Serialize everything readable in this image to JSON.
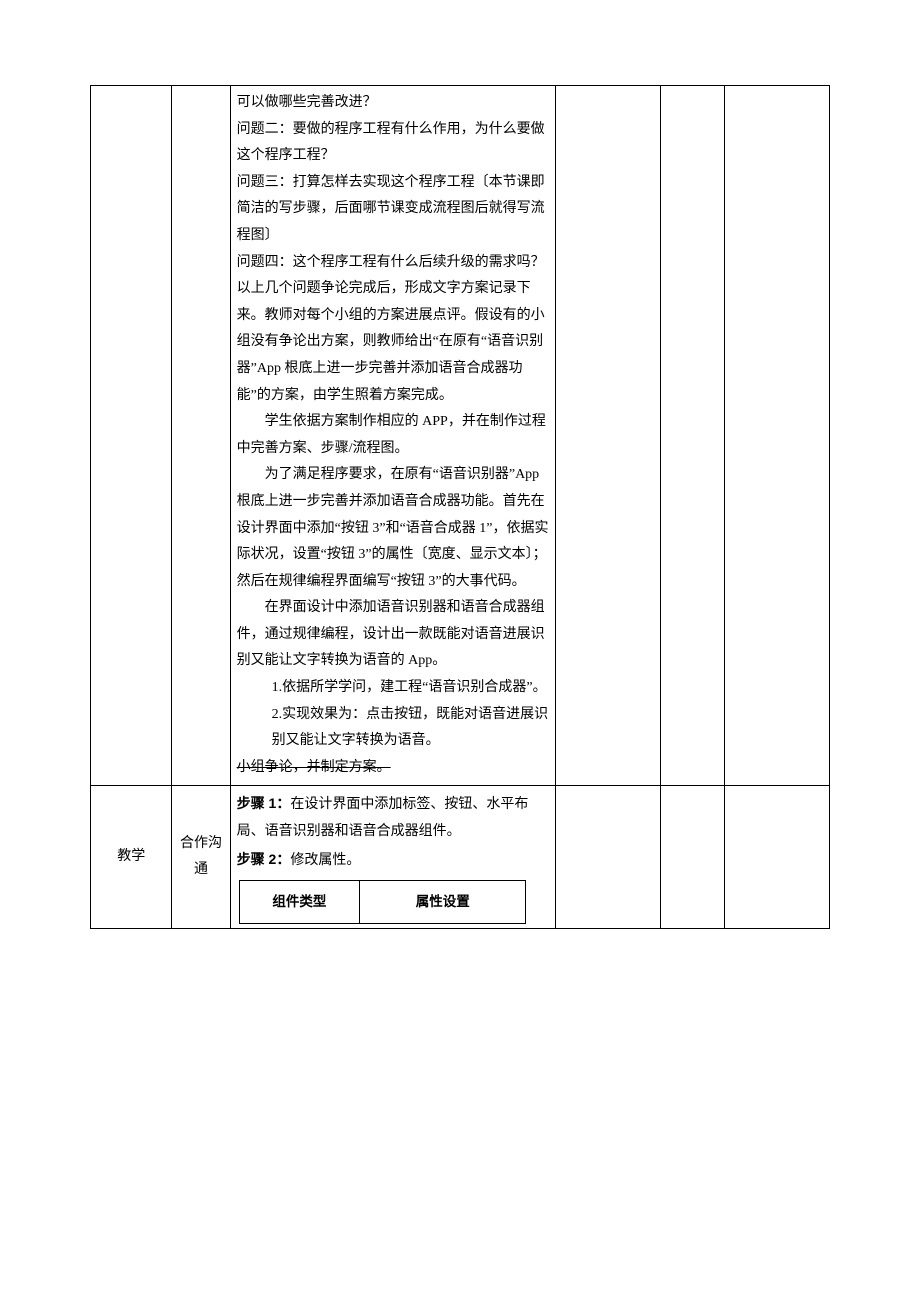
{
  "row1": {
    "c": {
      "p1": "可以做哪些完善改进？",
      "p2": "问题二：要做的程序工程有什么作用，为什么要做这个程序工程？",
      "p3": "问题三：打算怎样去实现这个程序工程〔本节课即简洁的写步骤，后面哪节课变成流程图后就得写流程图〕",
      "p4": "问题四：这个程序工程有什么后续升级的需求吗？",
      "p5": "以上几个问题争论完成后，形成文字方案记录下来。教师对每个小组的方案进展点评。假设有的小组没有争论出方案，则教师给出“在原有“语音识别器”App 根底上进一步完善并添加语音合成器功能”的方案，由学生照着方案完成。",
      "p6": "学生依据方案制作相应的 APP，并在制作过程中完善方案、步骤/流程图。",
      "p7": "为了满足程序要求，在原有“语音识别器”App 根底上进一步完善并添加语音合成器功能。首先在设计界面中添加“按钮 3”和“语音合成器 1”，依据实际状况，设置“按钮 3”的属性〔宽度、显示文本〕；然后在规律编程界面编写“按钮 3”的大事代码。",
      "p8": "在界面设计中添加语音识别器和语音合成器组件，通过规律编程，设计出一款既能对语音进展识别又能让文字转换为语音的 App。",
      "li1": "1.依据所学学问，建工程“语音识别合成器”。",
      "li2": "2.实现效果为：点击按钮，既能对语音进展识别又能让文字转换为语音。",
      "p9": "小组争论，并制定方案。"
    }
  },
  "row2": {
    "a": "教学",
    "b": "合作沟通",
    "c": {
      "s1a": "步骤 1：",
      "s1b": "在设计界面中添加标签、按钮、水平布局、语音识别器和语音合成器组件。",
      "s2a": "步骤 2：",
      "s2b": "修改属性。",
      "th1": "组件类型",
      "th2": "属性设置"
    }
  }
}
